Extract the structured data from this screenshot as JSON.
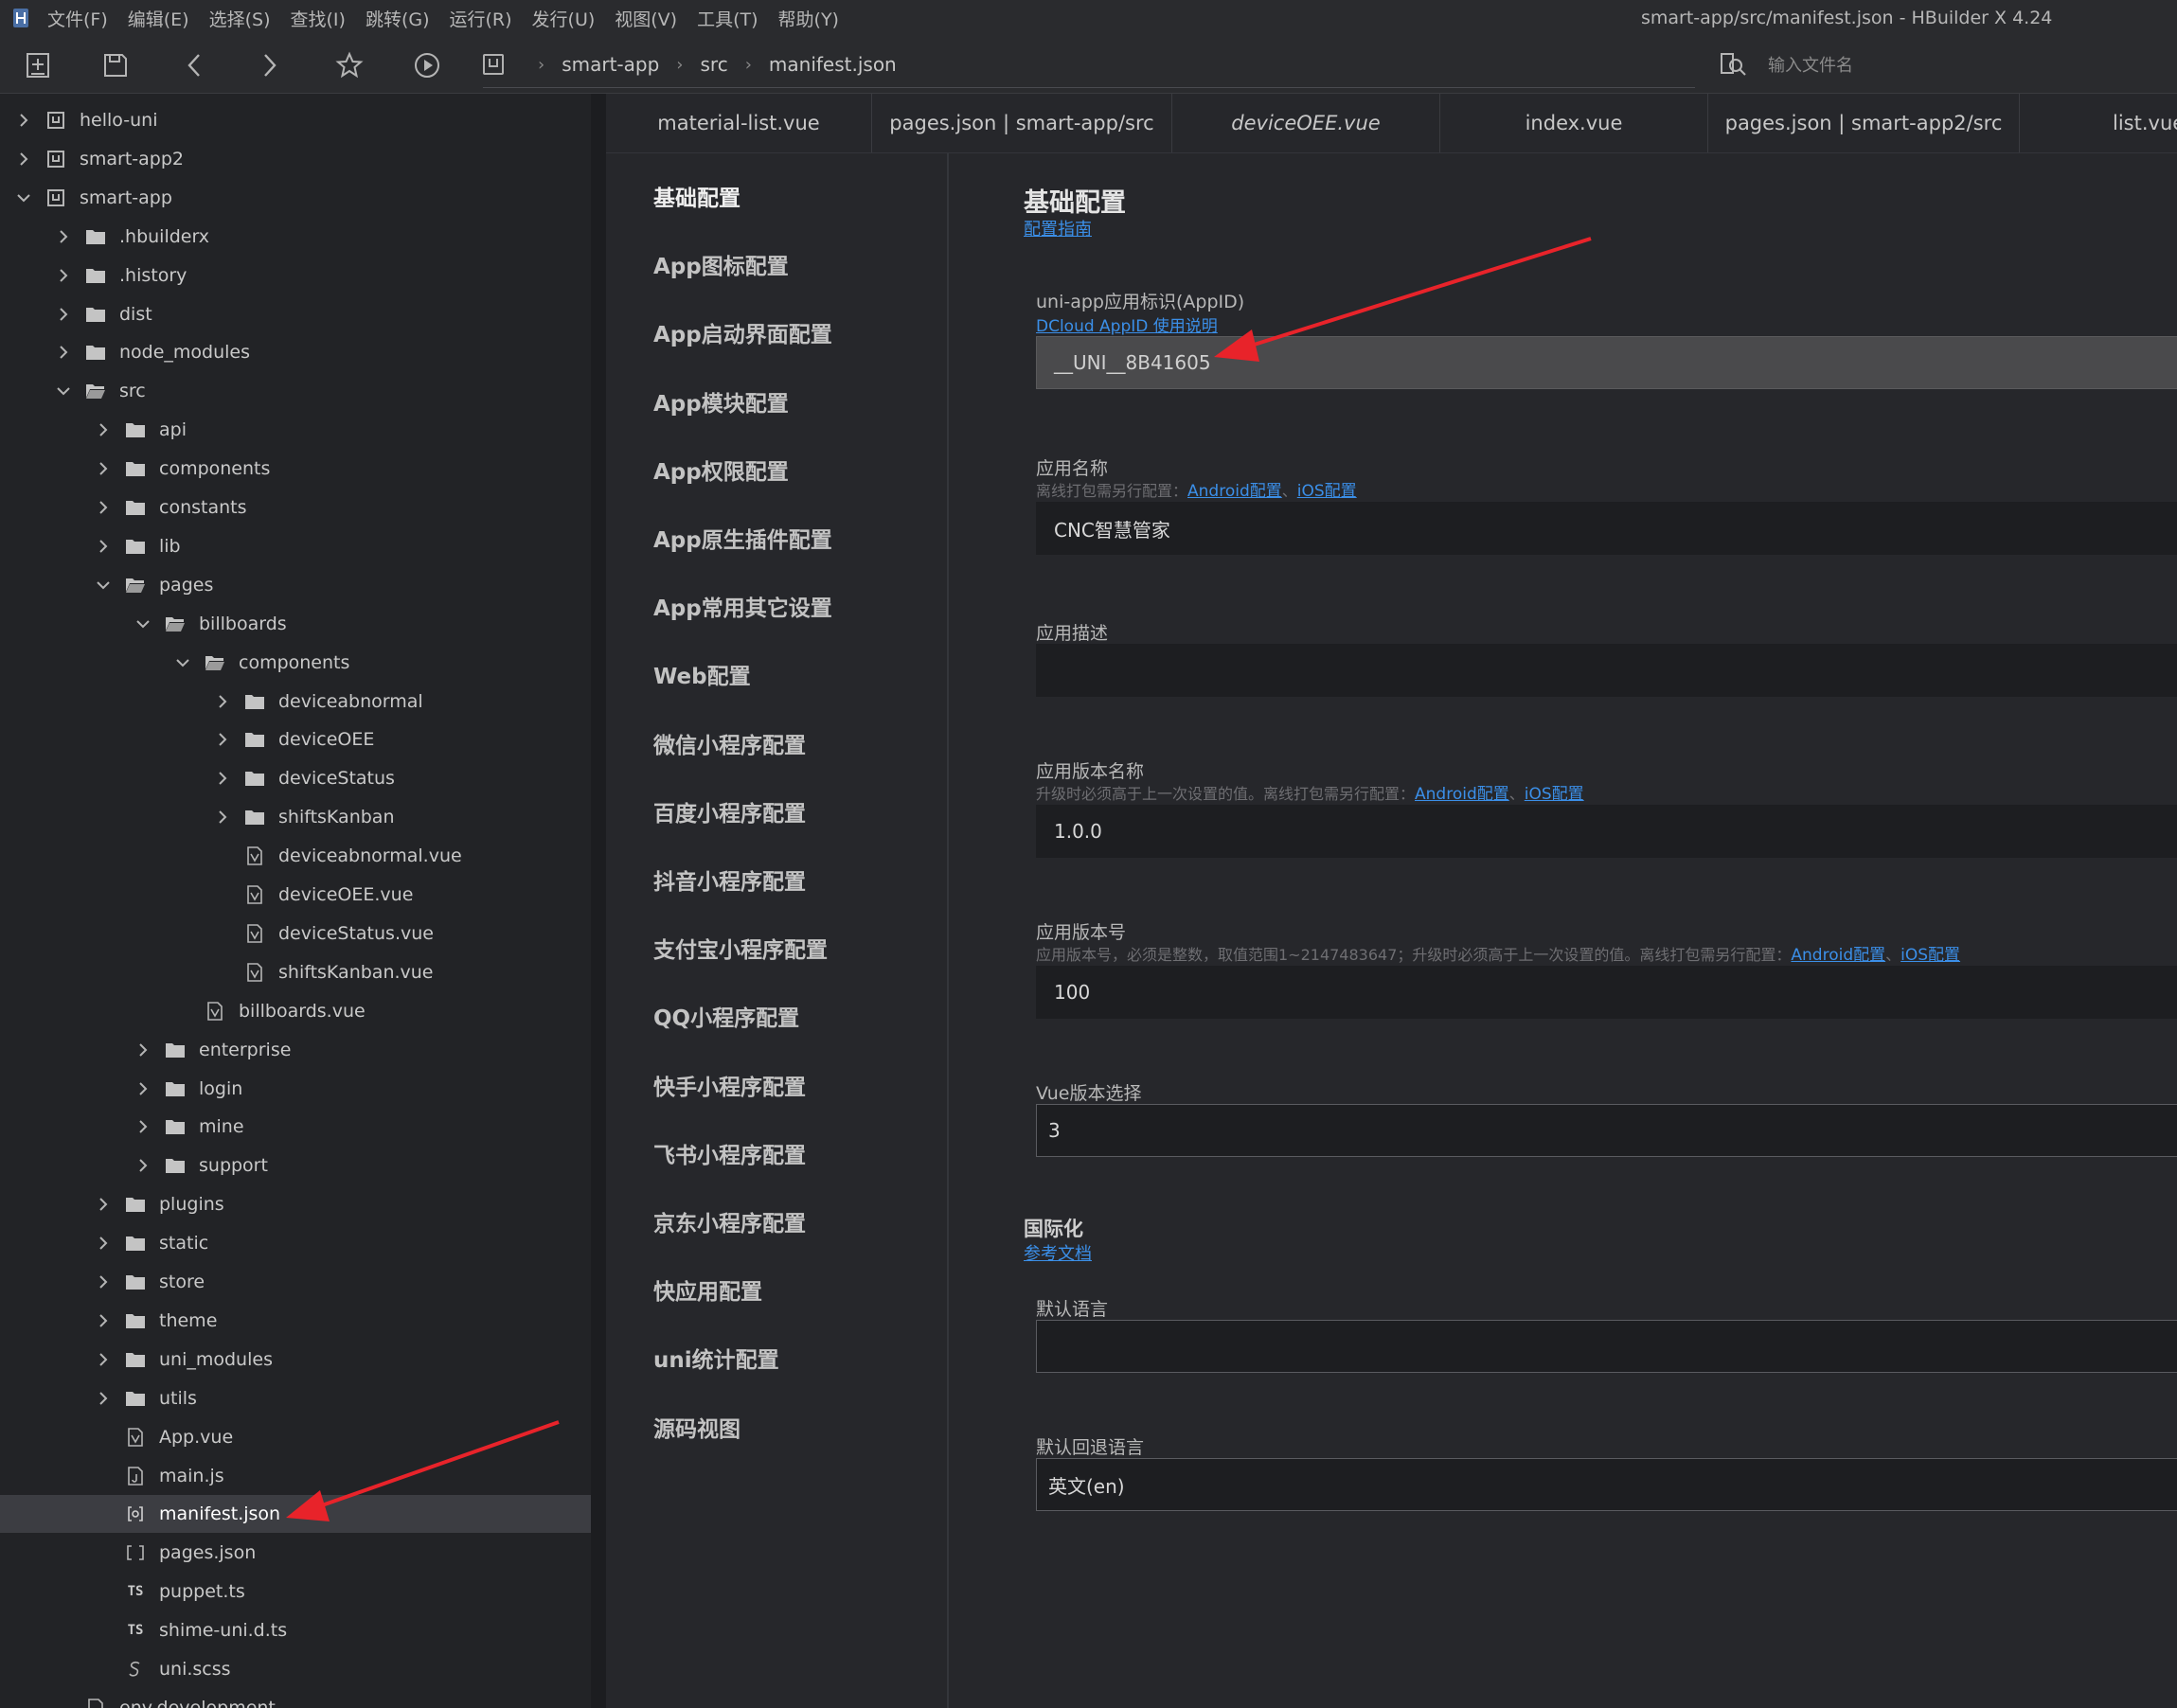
{
  "menubar": {
    "items": [
      "文件(F)",
      "编辑(E)",
      "选择(S)",
      "查找(I)",
      "跳转(G)",
      "运行(R)",
      "发行(U)",
      "视图(V)",
      "工具(T)",
      "帮助(Y)"
    ],
    "window_title": "smart-app/src/manifest.json - HBuilder X 4.24"
  },
  "toolbar": {
    "breadcrumb": [
      "smart-app",
      "src",
      "manifest.json"
    ],
    "search_placeholder": "输入文件名"
  },
  "tree": [
    {
      "label": "hello-uni",
      "type": "project",
      "depth": 0,
      "expand": "collapsed"
    },
    {
      "label": "smart-app2",
      "type": "project",
      "depth": 0,
      "expand": "collapsed"
    },
    {
      "label": "smart-app",
      "type": "project",
      "depth": 0,
      "expand": "expanded"
    },
    {
      "label": ".hbuilderx",
      "type": "folder",
      "depth": 1,
      "expand": "collapsed"
    },
    {
      "label": ".history",
      "type": "folder",
      "depth": 1,
      "expand": "collapsed"
    },
    {
      "label": "dist",
      "type": "folder",
      "depth": 1,
      "expand": "collapsed"
    },
    {
      "label": "node_modules",
      "type": "folder",
      "depth": 1,
      "expand": "collapsed"
    },
    {
      "label": "src",
      "type": "folder-open",
      "depth": 1,
      "expand": "expanded"
    },
    {
      "label": "api",
      "type": "folder",
      "depth": 2,
      "expand": "collapsed"
    },
    {
      "label": "components",
      "type": "folder",
      "depth": 2,
      "expand": "collapsed"
    },
    {
      "label": "constants",
      "type": "folder",
      "depth": 2,
      "expand": "collapsed"
    },
    {
      "label": "lib",
      "type": "folder",
      "depth": 2,
      "expand": "collapsed"
    },
    {
      "label": "pages",
      "type": "folder-open",
      "depth": 2,
      "expand": "expanded"
    },
    {
      "label": "billboards",
      "type": "folder-open",
      "depth": 3,
      "expand": "expanded"
    },
    {
      "label": "components",
      "type": "folder-open",
      "depth": 4,
      "expand": "expanded"
    },
    {
      "label": "deviceabnormal",
      "type": "folder",
      "depth": 5,
      "expand": "collapsed"
    },
    {
      "label": "deviceOEE",
      "type": "folder",
      "depth": 5,
      "expand": "collapsed"
    },
    {
      "label": "deviceStatus",
      "type": "folder",
      "depth": 5,
      "expand": "collapsed"
    },
    {
      "label": "shiftsKanban",
      "type": "folder",
      "depth": 5,
      "expand": "collapsed"
    },
    {
      "label": "deviceabnormal.vue",
      "type": "vue",
      "depth": 5,
      "expand": "none"
    },
    {
      "label": "deviceOEE.vue",
      "type": "vue",
      "depth": 5,
      "expand": "none"
    },
    {
      "label": "deviceStatus.vue",
      "type": "vue",
      "depth": 5,
      "expand": "none"
    },
    {
      "label": "shiftsKanban.vue",
      "type": "vue",
      "depth": 5,
      "expand": "none"
    },
    {
      "label": "billboards.vue",
      "type": "vue",
      "depth": 4,
      "expand": "none"
    },
    {
      "label": "enterprise",
      "type": "folder",
      "depth": 3,
      "expand": "collapsed"
    },
    {
      "label": "login",
      "type": "folder",
      "depth": 3,
      "expand": "collapsed"
    },
    {
      "label": "mine",
      "type": "folder",
      "depth": 3,
      "expand": "collapsed"
    },
    {
      "label": "support",
      "type": "folder",
      "depth": 3,
      "expand": "collapsed"
    },
    {
      "label": "plugins",
      "type": "folder",
      "depth": 2,
      "expand": "collapsed"
    },
    {
      "label": "static",
      "type": "folder",
      "depth": 2,
      "expand": "collapsed"
    },
    {
      "label": "store",
      "type": "folder",
      "depth": 2,
      "expand": "collapsed"
    },
    {
      "label": "theme",
      "type": "folder",
      "depth": 2,
      "expand": "collapsed"
    },
    {
      "label": "uni_modules",
      "type": "folder",
      "depth": 2,
      "expand": "collapsed"
    },
    {
      "label": "utils",
      "type": "folder",
      "depth": 2,
      "expand": "collapsed"
    },
    {
      "label": "App.vue",
      "type": "vue",
      "depth": 2,
      "expand": "none"
    },
    {
      "label": "main.js",
      "type": "js",
      "depth": 2,
      "expand": "none"
    },
    {
      "label": "manifest.json",
      "type": "manifest",
      "depth": 2,
      "expand": "none",
      "selected": true
    },
    {
      "label": "pages.json",
      "type": "json",
      "depth": 2,
      "expand": "none"
    },
    {
      "label": "puppet.ts",
      "type": "ts",
      "depth": 2,
      "expand": "none"
    },
    {
      "label": "shime-uni.d.ts",
      "type": "ts",
      "depth": 2,
      "expand": "none"
    },
    {
      "label": "uni.scss",
      "type": "scss",
      "depth": 2,
      "expand": "none"
    },
    {
      "label": "env.development",
      "type": "file",
      "depth": 1,
      "expand": "none"
    }
  ],
  "tabs": [
    "material-list.vue",
    "pages.json | smart-app/src",
    "deviceOEE.vue",
    "index.vue",
    "pages.json | smart-app2/src",
    "list.vue"
  ],
  "nav": [
    "基础配置",
    "App图标配置",
    "App启动界面配置",
    "App模块配置",
    "App权限配置",
    "App原生插件配置",
    "App常用其它设置",
    "Web配置",
    "微信小程序配置",
    "百度小程序配置",
    "抖音小程序配置",
    "支付宝小程序配置",
    "QQ小程序配置",
    "快手小程序配置",
    "飞书小程序配置",
    "京东小程序配置",
    "快应用配置",
    "uni统计配置",
    "源码视图"
  ],
  "basic": {
    "title": "基础配置",
    "guide_link": "配置指南",
    "appid": {
      "label": "uni-app应用标识(AppID)",
      "help_link": "DCloud AppID 使用说明",
      "value": "__UNI__8B41605"
    },
    "app_name": {
      "label": "应用名称",
      "hint": "离线打包需另行配置：",
      "android": "Android配置",
      "dot": "、",
      "ios": "iOS配置",
      "value": "CNC智慧管家"
    },
    "app_desc": {
      "label": "应用描述",
      "value": ""
    },
    "version_name": {
      "label": "应用版本名称",
      "hint": "升级时必须高于上一次设置的值。离线打包需另行配置：",
      "android": "Android配置",
      "dot": "、",
      "ios": "iOS配置",
      "value": "1.0.0"
    },
    "version_code": {
      "label": "应用版本号",
      "hint": "应用版本号，必须是整数，取值范围1~2147483647；升级时必须高于上一次设置的值。离线打包需另行配置：",
      "android": "Android配置",
      "dot": "、",
      "ios": "iOS配置",
      "value": "100"
    },
    "vue_version": {
      "label": "Vue版本选择",
      "value": "3"
    }
  },
  "i18n": {
    "title": "国际化",
    "doc_link": "参考文档",
    "default_locale": {
      "label": "默认语言",
      "value": ""
    },
    "fallback_locale": {
      "label": "默认回退语言",
      "value": "英文(en)"
    }
  },
  "colors": {
    "link": "#3b8fe8",
    "annotation_arrow": "#e8232a",
    "selected_row": "#3c3d42"
  }
}
